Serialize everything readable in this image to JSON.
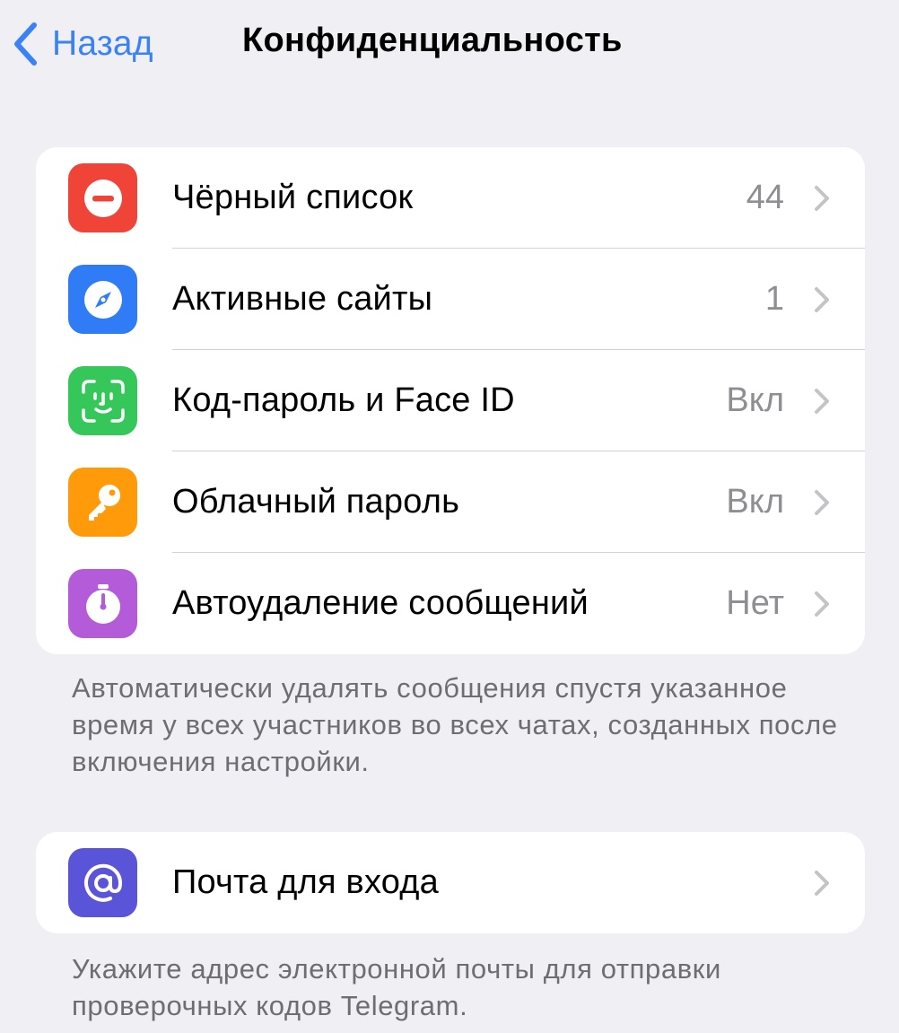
{
  "nav": {
    "back_label": "Назад",
    "title": "Конфиденциальность"
  },
  "groups": [
    {
      "items": [
        {
          "label": "Чёрный список",
          "value": "44",
          "icon": "blocked-icon",
          "color": "#f04438"
        },
        {
          "label": "Активные сайты",
          "value": "1",
          "icon": "compass-icon",
          "color": "#2f7cf6"
        },
        {
          "label": "Код-пароль и Face ID",
          "value": "Вкл",
          "icon": "face-id-icon",
          "color": "#35c759"
        },
        {
          "label": "Облачный пароль",
          "value": "Вкл",
          "icon": "key-icon",
          "color": "#ff9a0a"
        },
        {
          "label": "Автоудаление сообщений",
          "value": "Нет",
          "icon": "timer-icon",
          "color": "#b45bd9"
        }
      ],
      "footer": "Автоматически удалять сообщения спустя указанное время у всех участников во всех чатах, созданных после включения настройки."
    },
    {
      "items": [
        {
          "label": "Почта для входа",
          "value": "",
          "icon": "at-sign-icon",
          "color": "#5a55d8"
        }
      ],
      "footer": "Укажите адрес электронной почты для отправки проверочных кодов Telegram."
    }
  ]
}
